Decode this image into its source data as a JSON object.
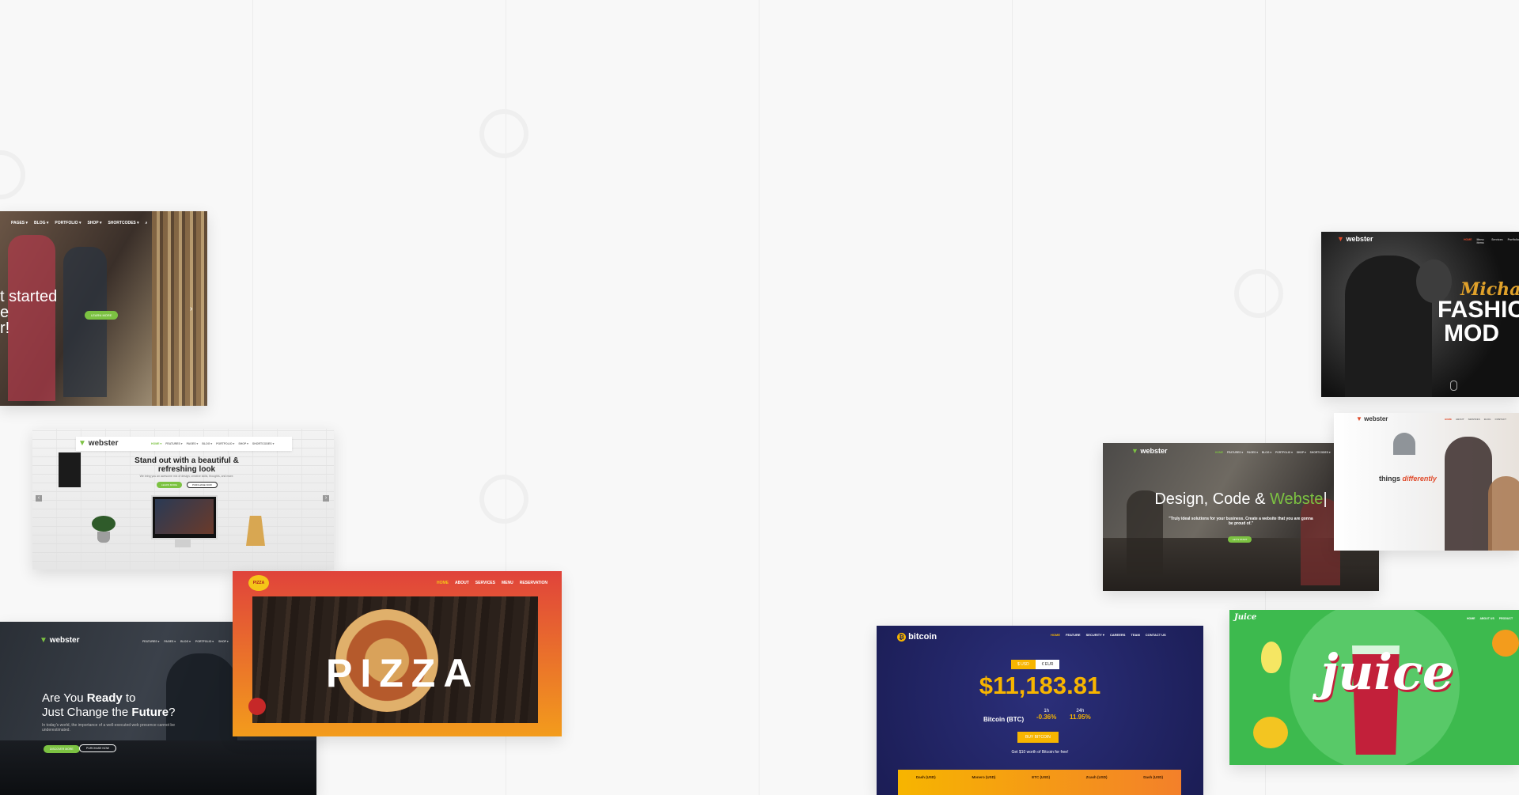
{
  "card_business": {
    "nav": [
      "PAGES ▾",
      "BLOG ▾",
      "PORTFOLIO ▾",
      "SHOP ▾",
      "SHORTCODES ▾"
    ],
    "hero": [
      "t started",
      "e",
      "r!"
    ],
    "button": "LEARN MORE"
  },
  "card_refresh": {
    "logo": "webster",
    "nav": [
      "HOME ▾",
      "FEATURES ▾",
      "PAGES ▾",
      "BLOG ▾",
      "PORTFOLIO ▾",
      "SHOP ▾",
      "SHORTCODES ▾"
    ],
    "title_line1": "Stand out with a beautiful &",
    "title_line2": "refreshing look",
    "subtitle": "We bring you an awesome mix of design, creative skills, thoughts, and more.",
    "btn1": "LEARN MORE",
    "btn2": "PURCHASE NOW"
  },
  "card_future": {
    "logo": "webster",
    "nav": [
      "FEATURES ▾",
      "PAGES ▾",
      "BLOG ▾",
      "PORTFOLIO ▾",
      "SHOP ▾"
    ],
    "heading_pre": "Are You ",
    "heading_bold": "Ready",
    "heading_post": " to",
    "heading2_pre": "Just Change the ",
    "heading2_bold": "Future",
    "heading2_post": "?",
    "body": "In today's world, the importance of a well-executed web presence cannot be underestimated.",
    "btn1": "DISCOVER MORE",
    "btn2": "PURCHASE NOW"
  },
  "card_pizza": {
    "nav": [
      "HOME",
      "ABOUT",
      "SERVICES",
      "MENU",
      "RESERVATION"
    ],
    "badge": "PIZZA",
    "word": "PIZZA"
  },
  "card_bitcoin": {
    "logo": "bitcoin",
    "nav": [
      "HOME",
      "FEATURE",
      "SECURITY ▾",
      "CAREERS",
      "TEAM",
      "CONTACT US"
    ],
    "toggle_usd": "$ USD",
    "toggle_eur": "€ EUR",
    "price": "$11,183.81",
    "coin": "Bitcoin (BTC)",
    "h1_label": "1h",
    "h1_value": "-0.36%",
    "h24_label": "24h",
    "h24_value": "11.95%",
    "button": "BUY BITCOIN",
    "promo": "Get $10 worth of Bitcoin for free!",
    "tickers": [
      "Dash (USD)",
      "Monero (USD)",
      "ETC (USD)",
      "Zcash (USD)",
      "Dash (USD)"
    ]
  },
  "card_design": {
    "logo": "webster",
    "nav": [
      "HOME",
      "FEATURES ▾",
      "PAGES ▾",
      "BLOG ▾",
      "PORTFOLIO ▾",
      "SHOP ▾",
      "SHORTCODES ▾"
    ],
    "heading_pre": "Design, Code & ",
    "heading_accent": "Webste",
    "heading_cursor": "|",
    "quote": "\"Truly ideal solutions for your business. Create a website that you are gonna be proud of.\"",
    "button": "LET'S START"
  },
  "card_fashion": {
    "logo": "webster",
    "nav": [
      "HOME",
      "Menu items",
      "Services",
      "Portfolio"
    ],
    "script": "Michael",
    "line1": "FASHIO",
    "line2": "MOD"
  },
  "card_different": {
    "logo": "webster",
    "nav": [
      "HOME",
      "ABOUT",
      "SERVICES",
      "BLOG",
      "CONTACT"
    ],
    "text_pre": "things ",
    "text_accent": "differently"
  },
  "card_juice": {
    "logo": "Juice",
    "nav": [
      "HOME",
      "ABOUT US",
      "PRODUCT"
    ],
    "word": "juice"
  },
  "colors": {
    "green": "#7cc242",
    "pizza_red": "#e0433b",
    "pizza_orange": "#f39c1c",
    "bitcoin_navy": "#1f2363",
    "bitcoin_gold": "#f7b500",
    "juice_green": "#3dba4e"
  }
}
